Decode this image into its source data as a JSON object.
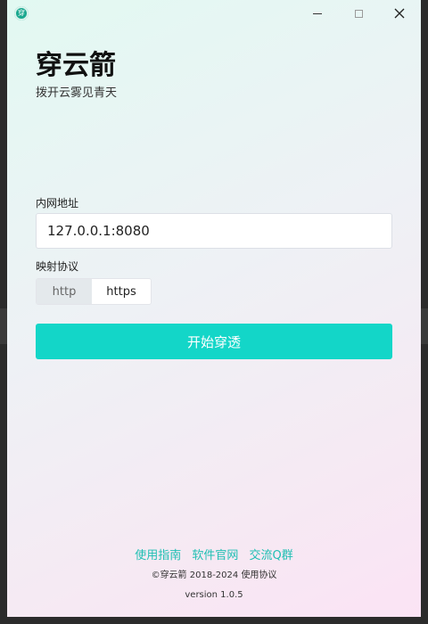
{
  "window": {
    "title": "穿云箭",
    "icon": "app-logo-icon",
    "icon_glyph": "穿",
    "controls": {
      "minimize_icon": "minimize-icon",
      "maximize_icon": "maximize-icon",
      "close_icon": "close-icon"
    }
  },
  "header": {
    "title": "穿云箭",
    "subtitle": "拨开云雾见青天"
  },
  "form": {
    "address_label": "内网地址",
    "address_value": "127.0.0.1:8080",
    "protocol_label": "映射协议",
    "protocol_options": [
      "http",
      "https"
    ],
    "protocol_selected": "https",
    "start_button": "开始穿透"
  },
  "footer": {
    "links": [
      "使用指南",
      "软件官网",
      "交流Q群"
    ],
    "copyright_prefix": "©穿云箭 2018-2024",
    "agreement_link": "使用协议",
    "version": "version 1.0.5"
  },
  "colors": {
    "accent": "#13d6c8",
    "link": "#1fbfb3",
    "background_start": "#e2f9f2",
    "background_end": "#fbe3f4"
  }
}
